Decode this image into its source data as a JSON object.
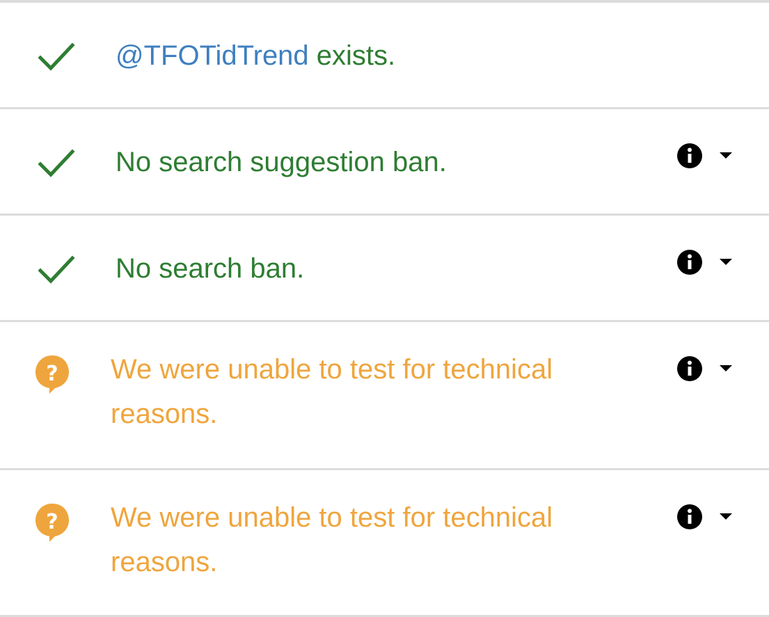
{
  "colors": {
    "success": "#2e7d32",
    "handle": "#3f7fbf",
    "warning": "#efa53d",
    "divider": "#dcdcdc",
    "icon": "#000000"
  },
  "rows": [
    {
      "status": "success",
      "status_icon": "check-icon",
      "handle": "@TFOTidTrend",
      "text": " exists.",
      "has_details": false
    },
    {
      "status": "success",
      "status_icon": "check-icon",
      "text": "No search suggestion ban.",
      "has_details": true,
      "info_icon": "info-icon",
      "expand_icon": "caret-down-icon"
    },
    {
      "status": "success",
      "status_icon": "check-icon",
      "text": "No search ban.",
      "has_details": true,
      "info_icon": "info-icon",
      "expand_icon": "caret-down-icon"
    },
    {
      "status": "warning",
      "status_icon": "question-bubble-icon",
      "text": "We were unable to test for technical reasons.",
      "has_details": true,
      "info_icon": "info-icon",
      "expand_icon": "caret-down-icon"
    },
    {
      "status": "warning",
      "status_icon": "question-bubble-icon",
      "text": "We were unable to test for technical reasons.",
      "has_details": true,
      "info_icon": "info-icon",
      "expand_icon": "caret-down-icon"
    }
  ]
}
